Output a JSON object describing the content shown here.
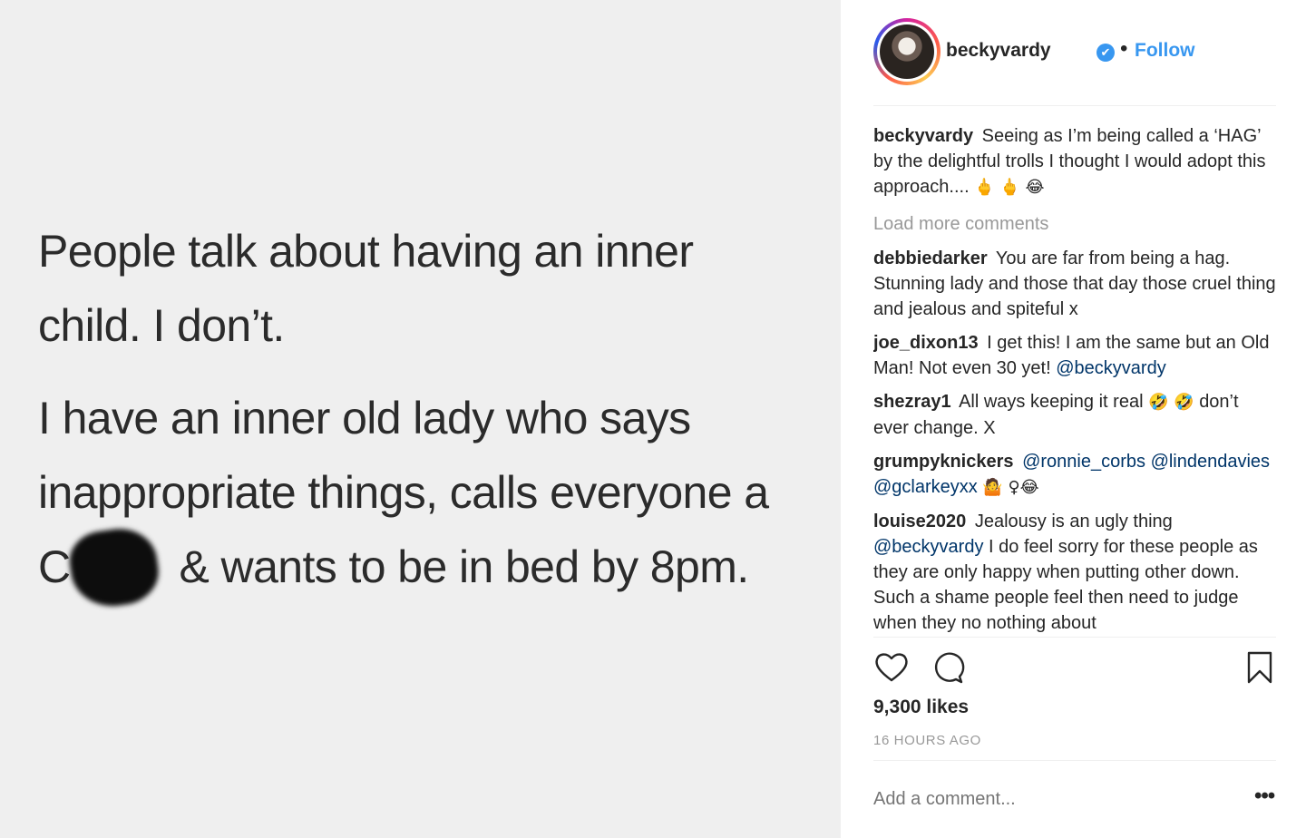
{
  "post_image": {
    "line1": "People talk about having an inner",
    "line2": "child. I don’t.",
    "line3": "I have an inner old lady who says",
    "line4": "inappropriate things, calls everyone a",
    "line5_start": "C",
    "line5_end": "& wants to be in bed by 8pm."
  },
  "header": {
    "username": "beckyvardy",
    "verified_icon": "✔",
    "separator": "•",
    "follow_label": "Follow"
  },
  "caption": {
    "user": "beckyvardy",
    "text": "Seeing as I’m being called a ‘HAG’ by the delightful trolls I thought I would adopt this approach....",
    "emoji": "🖕 🖕 😂"
  },
  "load_more": "Load more comments",
  "comments": [
    {
      "user": "debbiedarker",
      "text": "You are far from being a hag. Stunning lady and those that day those cruel thing and jealous and spiteful x"
    },
    {
      "user": "joe_dixon13",
      "text": "I get this! I am the same but an Old Man! Not even 30 yet!",
      "mention": "@beckyvardy"
    },
    {
      "user": "shezray1",
      "text": "All ways keeping it real",
      "emoji": "🤣 🤣",
      "text2": "don’t ever change. X"
    },
    {
      "user": "grumpyknickers",
      "mentions": "@ronnie_corbs @lindendavies @gclarkeyxx",
      "emoji": "🤷 ♀😂"
    },
    {
      "user": "louise2020",
      "text": "Jealousy is an ugly thing",
      "mention": "@beckyvardy",
      "text2": "I do feel sorry for these people as they are only happy when putting other down. Such a shame people feel then need to judge when they no nothing about"
    }
  ],
  "likes": "9,300 likes",
  "time": "16 HOURS AGO",
  "add_comment_placeholder": "Add a comment...",
  "more_label": "•••",
  "colors": {
    "link": "#3897f0",
    "mention": "#003569",
    "muted": "#999999",
    "text": "#262626"
  }
}
